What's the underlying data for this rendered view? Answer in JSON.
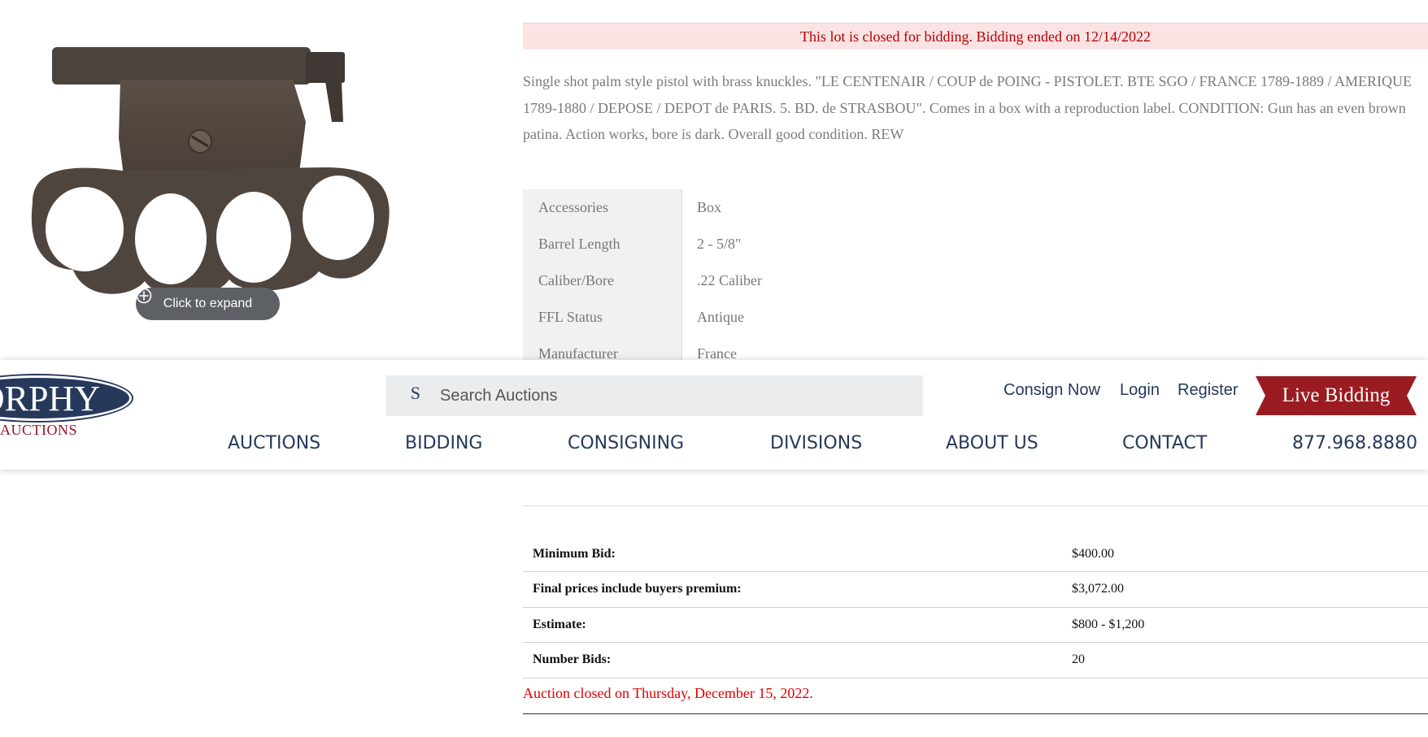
{
  "image": {
    "expand_label": "Click to expand"
  },
  "lot": {
    "closed_banner": "This lot is closed for bidding. Bidding ended on 12/14/2022",
    "description": "Single shot palm style pistol with brass knuckles. \"LE CENTENAIR / COUP de POING - PISTOLET. BTE SGO / FRANCE 1789-1889 / AMERIQUE 1789-1880 / DEPOSE / DEPOT de PARIS. 5. BD. de STRASBOU\". Comes in a box with a reproduction label. CONDITION: Gun has an even brown patina. Action works, bore is dark. Overall good condition. REW",
    "specs": [
      {
        "label": "Accessories",
        "value": "Box"
      },
      {
        "label": "Barrel Length",
        "value": "2 - 5/8\""
      },
      {
        "label": "Caliber/Bore",
        "value": ".22 Caliber"
      },
      {
        "label": "FFL Status",
        "value": "Antique"
      },
      {
        "label": "Manufacturer",
        "value": "France"
      }
    ]
  },
  "header": {
    "logo_text": "ORPHY",
    "logo_sub": "AUCTIONS",
    "search_icon_glyph": "S",
    "search_placeholder": "Search Auctions",
    "consign_label": "Consign Now",
    "login_label": "Login",
    "register_label": "Register",
    "live_bidding_label": "Live Bidding",
    "nav": {
      "auctions": "AUCTIONS",
      "bidding": "BIDDING",
      "consigning": "CONSIGNING",
      "divisions": "DIVISIONS",
      "about": "ABOUT US",
      "contact": "CONTACT",
      "phone": "877.968.8880"
    }
  },
  "bid_info": {
    "rows": [
      {
        "label": "Minimum Bid:",
        "value": "$400.00"
      },
      {
        "label": "Final prices include buyers premium:",
        "value": "$3,072.00"
      },
      {
        "label": "Estimate:",
        "value": "$800 - $1,200"
      },
      {
        "label": "Number Bids:",
        "value": "20"
      }
    ],
    "closed_note": "Auction closed on Thursday, December 15, 2022."
  },
  "colors": {
    "brand_navy": "#26395b",
    "brand_red": "#9a1c22",
    "alert_red": "#e00000"
  }
}
